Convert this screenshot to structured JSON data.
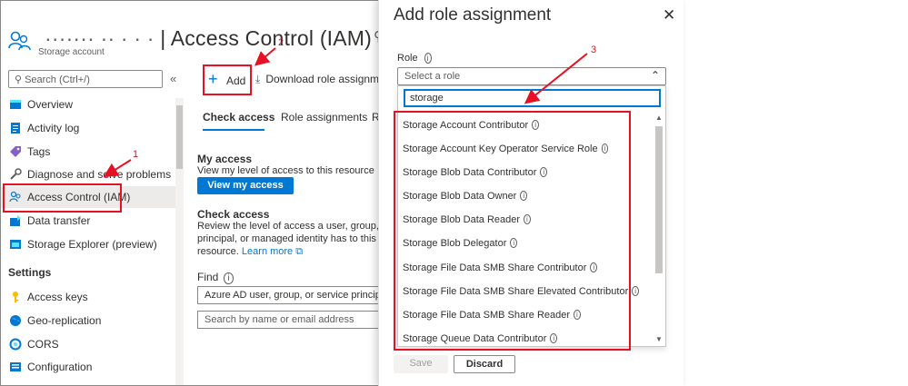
{
  "header": {
    "title_blur": "······· ··  ·  ·  ·",
    "title": "| Access Control (IAM)",
    "subtitle": "Storage account",
    "pin_icon": "pin-icon"
  },
  "sidebar": {
    "search_placeholder": "Search (Ctrl+/)",
    "collapse": "«",
    "items": [
      {
        "label": "Overview",
        "icon": "overview-icon"
      },
      {
        "label": "Activity log",
        "icon": "activity-log-icon"
      },
      {
        "label": "Tags",
        "icon": "tag-icon"
      },
      {
        "label": "Diagnose and solve problems",
        "icon": "wrench-icon"
      },
      {
        "label": "Access Control (IAM)",
        "icon": "people-icon"
      },
      {
        "label": "Data transfer",
        "icon": "data-transfer-icon"
      },
      {
        "label": "Storage Explorer (preview)",
        "icon": "storage-explorer-icon"
      }
    ],
    "settings_header": "Settings",
    "settings_items": [
      {
        "label": "Access keys",
        "icon": "key-icon"
      },
      {
        "label": "Geo-replication",
        "icon": "globe-icon"
      },
      {
        "label": "CORS",
        "icon": "cors-icon"
      },
      {
        "label": "Configuration",
        "icon": "configuration-icon"
      }
    ]
  },
  "toolbar": {
    "add_label": "Add",
    "download_label": "Download role assignment"
  },
  "tabs": {
    "check_access": "Check access",
    "role_assignments": "Role assignments",
    "more": "R"
  },
  "my_access": {
    "heading": "My access",
    "text": "View my level of access to this resource",
    "button": "View my access"
  },
  "check_access": {
    "heading": "Check access",
    "line1": "Review the level of access a user, group, ser",
    "line2": "principal, or managed identity has to this",
    "line3": "resource.",
    "learn_more": "Learn more",
    "find_label": "Find",
    "find_value": "Azure AD user, group, or service principal",
    "search_placeholder": "Search by name or email address"
  },
  "panel": {
    "title": "Add role assignment",
    "close": "✕",
    "role_label": "Role",
    "role_placeholder": "Select a role",
    "filter_value": "storage",
    "options": [
      "Storage Account Contributor",
      "Storage Account Key Operator Service Role",
      "Storage Blob Data Contributor",
      "Storage Blob Data Owner",
      "Storage Blob Data Reader",
      "Storage Blob Delegator",
      "Storage File Data SMB Share Contributor",
      "Storage File Data SMB Share Elevated Contributor",
      "Storage File Data SMB Share Reader",
      "Storage Queue Data Contributor"
    ],
    "save": "Save",
    "discard": "Discard"
  },
  "annotations": {
    "n1": "1",
    "n2": "2",
    "n3": "3",
    "color": "#e81123"
  },
  "colors": {
    "accent": "#0078d4",
    "annotation": "#e81123"
  }
}
